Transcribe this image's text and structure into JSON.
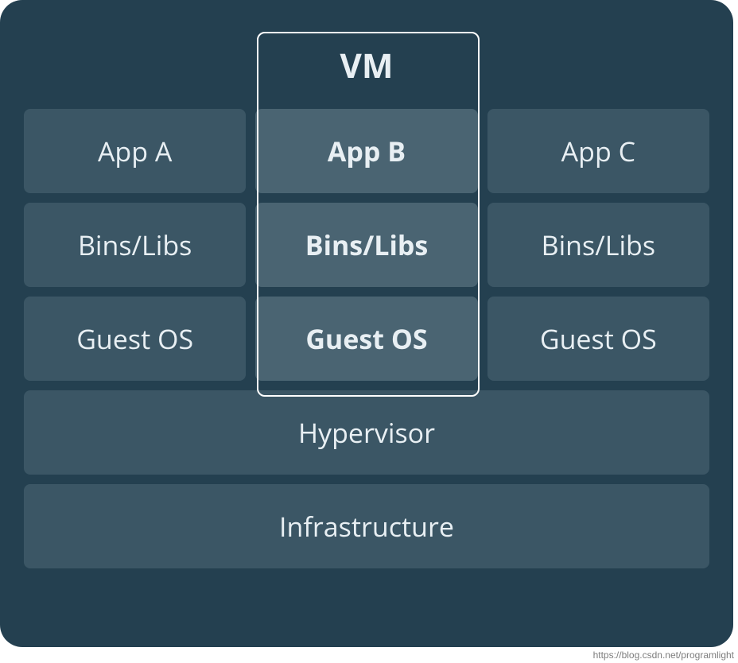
{
  "title": "VM",
  "columns": [
    {
      "highlight": false,
      "app": "App A",
      "bins": "Bins/Libs",
      "os": "Guest OS"
    },
    {
      "highlight": true,
      "app": "App B",
      "bins": "Bins/Libs",
      "os": "Guest OS"
    },
    {
      "highlight": false,
      "app": "App C",
      "bins": "Bins/Libs",
      "os": "Guest OS"
    }
  ],
  "layers": {
    "hypervisor": "Hypervisor",
    "infrastructure": "Infrastructure"
  },
  "watermark": "https://blog.csdn.net/programlight"
}
